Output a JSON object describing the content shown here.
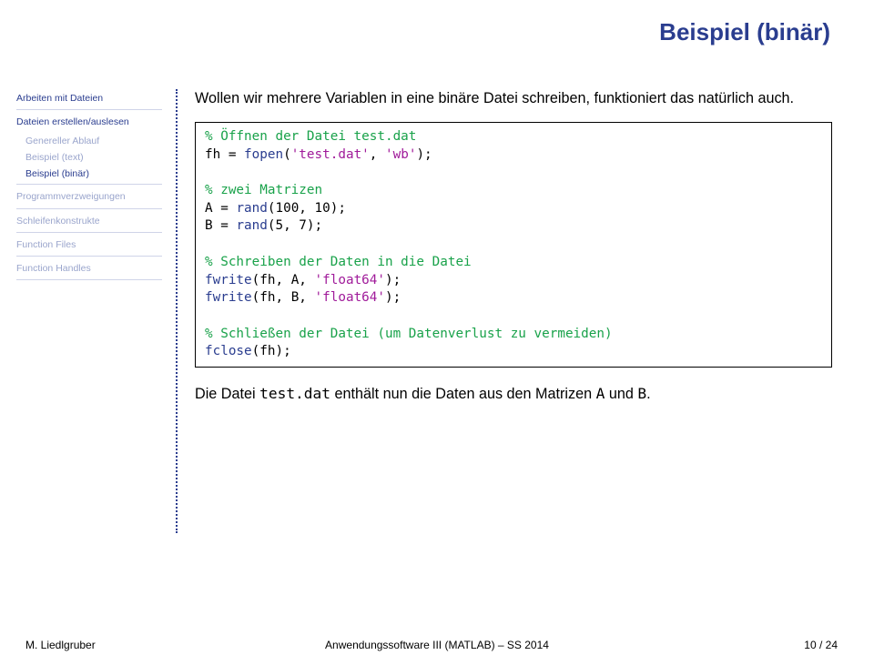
{
  "title": "Beispiel (binär)",
  "sidebar": {
    "items": [
      {
        "label": "Arbeiten mit Dateien",
        "class": "sec"
      },
      {
        "label": "Dateien erstellen/auslesen",
        "class": "sec"
      },
      {
        "label": "Genereller Ablauf",
        "class": "sub muted"
      },
      {
        "label": "Beispiel (text)",
        "class": "sub muted"
      },
      {
        "label": "Beispiel (binär)",
        "class": "sub active"
      },
      {
        "label": "Programmverzweigungen",
        "class": "sec muted"
      },
      {
        "label": "Schleifenkonstrukte",
        "class": "sec muted"
      },
      {
        "label": "Function Files",
        "class": "sec muted"
      },
      {
        "label": "Function Handles",
        "class": "sec muted"
      }
    ]
  },
  "content": {
    "intro": "Wollen wir mehrere Variablen in eine binäre Datei schreiben, funktioniert das natürlich auch.",
    "code": {
      "c1": "% Öffnen der Datei test.dat",
      "l2a": "fh = ",
      "l2b": "fopen",
      "l2c": "(",
      "l2d": "'test.dat'",
      "l2e": ", ",
      "l2f": "'wb'",
      "l2g": ");",
      "c3": "% zwei Matrizen",
      "l4a": "A = ",
      "l4b": "rand",
      "l4c": "(100, 10);",
      "l5a": "B = ",
      "l5b": "rand",
      "l5c": "(5, 7);",
      "c6": "% Schreiben der Daten in die Datei",
      "l7a": "fwrite",
      "l7b": "(fh, A, ",
      "l7c": "'float64'",
      "l7d": ");",
      "l8a": "fwrite",
      "l8b": "(fh, B, ",
      "l8c": "'float64'",
      "l8d": ");",
      "c9": "% Schließen der Datei (um Datenverlust zu vermeiden)",
      "l10a": "fclose",
      "l10b": "(fh);"
    },
    "outro_pre": "Die Datei ",
    "outro_tt1": "test.dat",
    "outro_mid": " enthält nun die Daten aus den Matrizen ",
    "outro_tt2": "A",
    "outro_mid2": " und ",
    "outro_tt3": "B",
    "outro_end": "."
  },
  "footer": {
    "left": "M. Liedlgruber",
    "center": "Anwendungssoftware III (MATLAB) – SS 2014",
    "right": "10 / 24"
  }
}
